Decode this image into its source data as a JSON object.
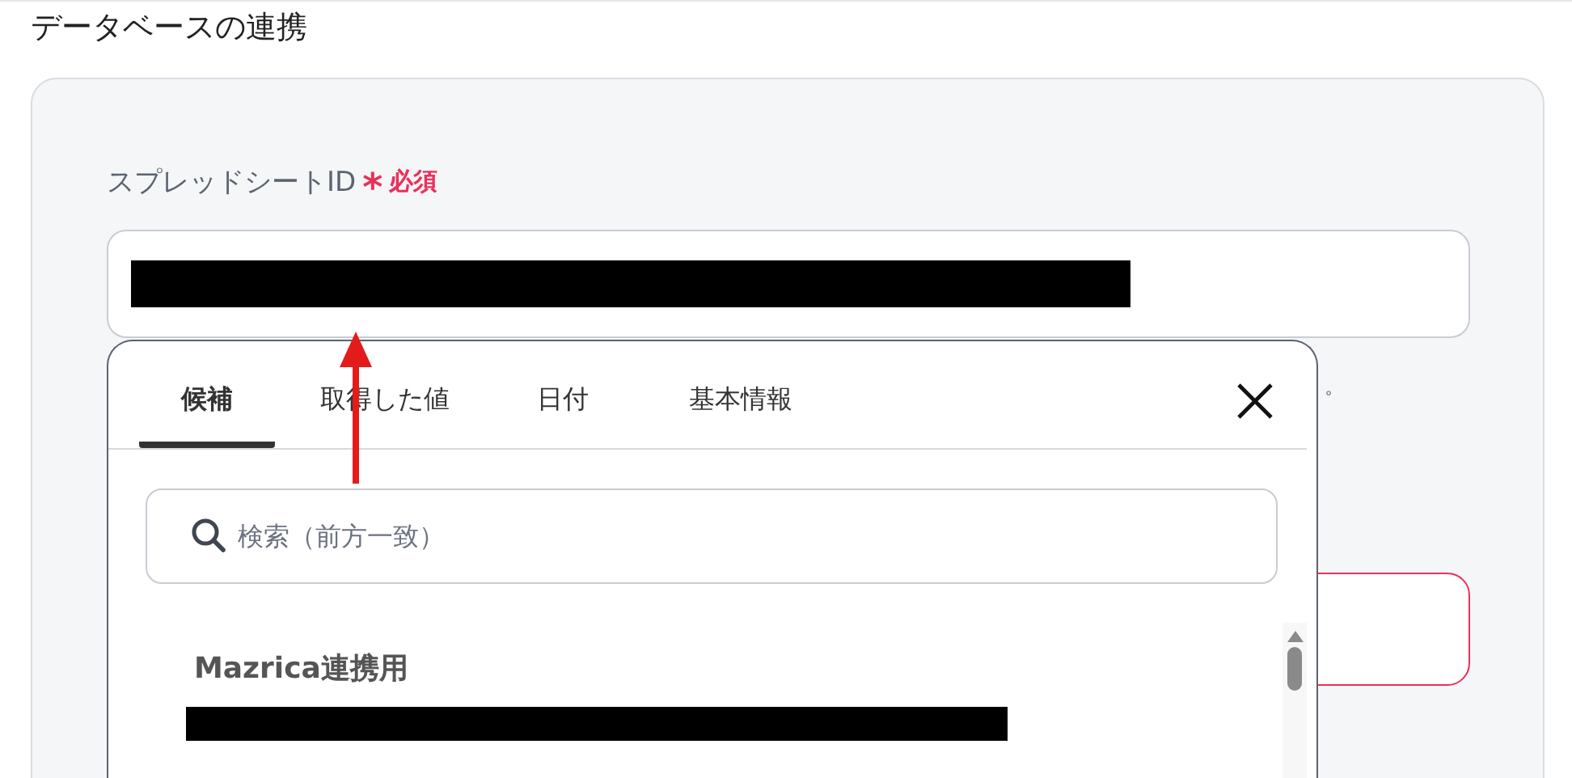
{
  "section_title": "データベースの連携",
  "field": {
    "label": "スプレッドシートID",
    "required_mark": "*",
    "required_text": "必須"
  },
  "help_text": "。",
  "picker": {
    "tabs": [
      {
        "label": "候補",
        "selected": true
      },
      {
        "label": "取得した値",
        "selected": false
      },
      {
        "label": "日付",
        "selected": false
      },
      {
        "label": "基本情報",
        "selected": false
      }
    ],
    "search": {
      "placeholder": "検索（前方一致）"
    },
    "items": [
      {
        "title": "Mazrica連携用"
      }
    ]
  }
}
